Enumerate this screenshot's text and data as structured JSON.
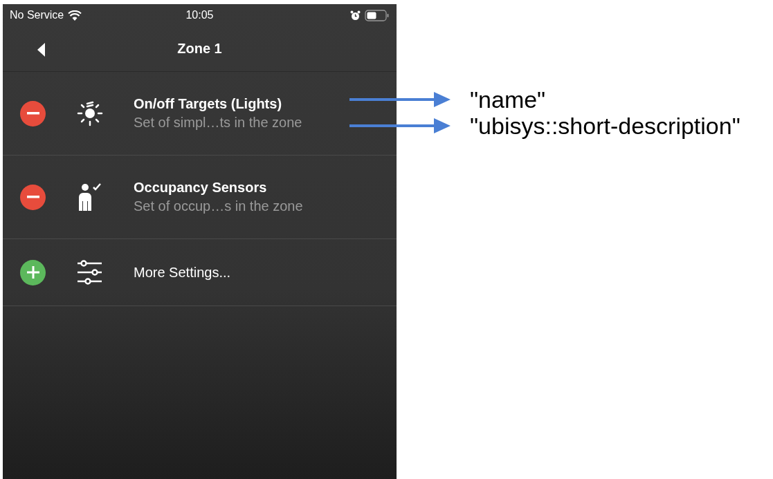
{
  "status_bar": {
    "carrier": "No Service",
    "time": "10:05"
  },
  "nav": {
    "title": "Zone 1"
  },
  "rows": [
    {
      "removable": true,
      "kind": "light",
      "name": "On/off Targets (Lights)",
      "description": "Set of simpl…ts in the zone"
    },
    {
      "removable": true,
      "kind": "occupancy",
      "name": "Occupancy Sensors",
      "description": "Set of occup…s in the zone"
    },
    {
      "removable": false,
      "kind": "settings",
      "name": "More Settings..."
    }
  ],
  "annotations": [
    {
      "label": "\"name\""
    },
    {
      "label": "\"ubisys::short-description\""
    }
  ]
}
